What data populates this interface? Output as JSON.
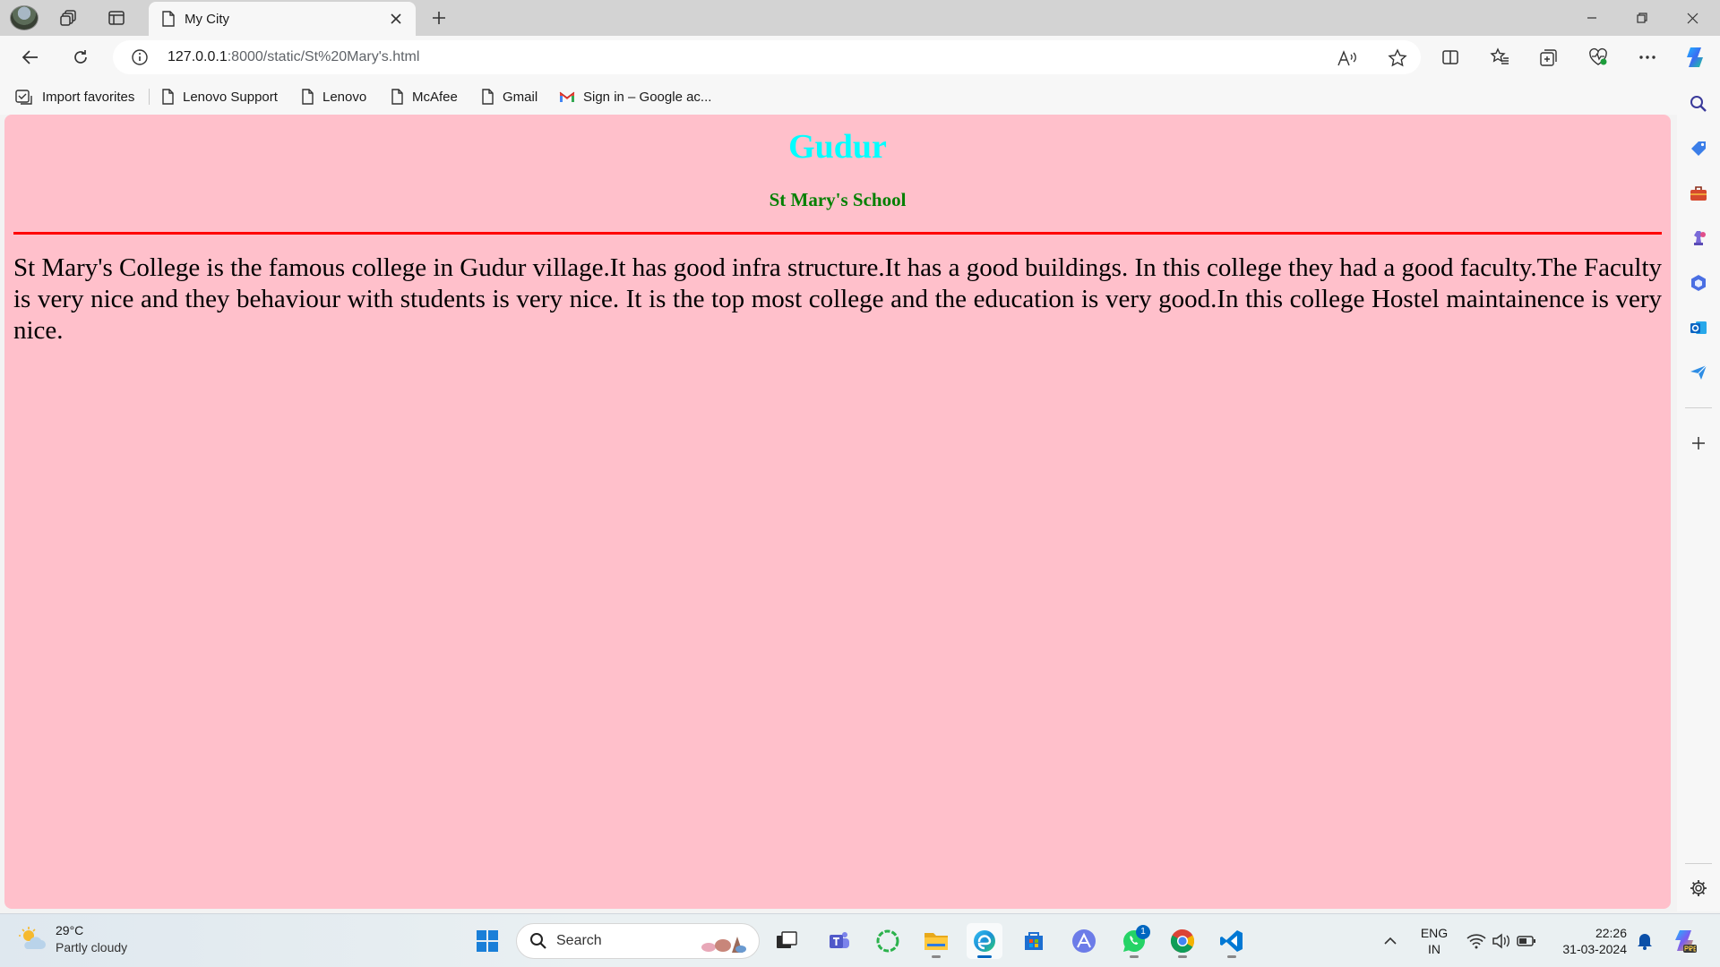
{
  "browser": {
    "tab_title": "My City",
    "url_host": "127.0.0.1",
    "url_rest": ":8000/static/St%20Mary's.html"
  },
  "favorites": [
    {
      "label": "Import favorites",
      "icon": "import-favorites-icon"
    },
    {
      "label": "Lenovo Support",
      "icon": "page-icon"
    },
    {
      "label": "Lenovo",
      "icon": "page-icon"
    },
    {
      "label": "McAfee",
      "icon": "page-icon"
    },
    {
      "label": "Gmail",
      "icon": "page-icon"
    },
    {
      "label": "Sign in – Google ac...",
      "icon": "gmail-icon"
    }
  ],
  "page": {
    "heading": "Gudur",
    "subheading": "St Mary's School",
    "body": "St Mary's College is the famous college in Gudur village.It has good infra structure.It has a good buildings. In this college they had a good faculty.The Faculty is very nice and they behaviour with students is very nice. It is the top most college and the education is very good.In this college Hostel maintainence is very nice.",
    "colors": {
      "background": "#ffc0cb",
      "heading": "#00ffff",
      "subheading": "#008000",
      "rule": "#ff0000"
    }
  },
  "taskbar": {
    "weather_temp": "29°C",
    "weather_desc": "Partly cloudy",
    "search_label": "Search",
    "whatsapp_badge": "1",
    "lang_top": "ENG",
    "lang_bottom": "IN",
    "time": "22:26",
    "date": "31-03-2024"
  }
}
